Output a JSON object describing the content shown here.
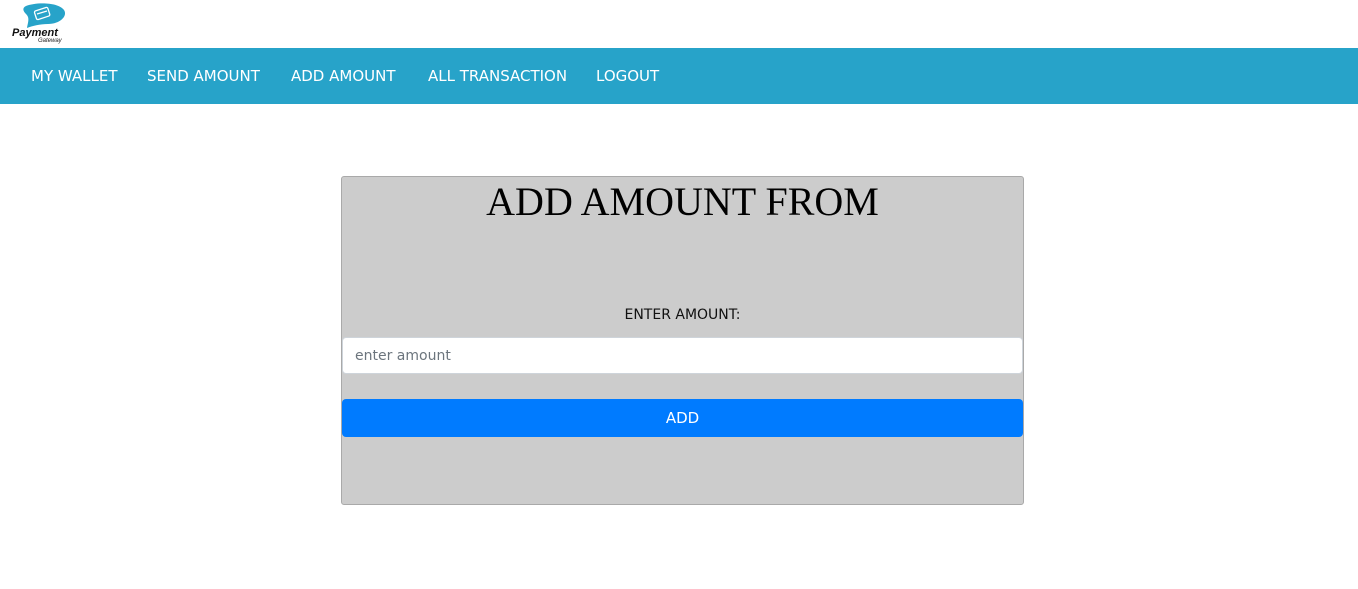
{
  "brand": {
    "name": "Payment",
    "tagline": "Gateway",
    "accent": "#27a3c9"
  },
  "nav": {
    "background": "#27a3c9",
    "items": [
      {
        "label": "MY WALLET"
      },
      {
        "label": "SEND AMOUNT"
      },
      {
        "label": "ADD AMOUNT"
      },
      {
        "label": "ALL TRANSACTION"
      },
      {
        "label": "LOGOUT"
      }
    ]
  },
  "form": {
    "title": "ADD AMOUNT FROM",
    "amount_label": "ENTER AMOUNT:",
    "amount_value": "",
    "amount_placeholder": "enter amount",
    "submit_label": "ADD",
    "button_color": "#007bff",
    "card_color": "#cccccc"
  }
}
